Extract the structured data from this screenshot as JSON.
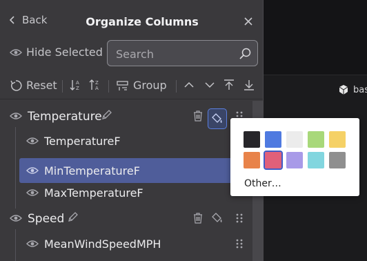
{
  "header": {
    "back_label": "Back",
    "title": "Organize Columns"
  },
  "controls": {
    "hide_selected_label": "Hide Selected",
    "search_placeholder": "Search"
  },
  "toolbar": {
    "reset_label": "Reset",
    "group_label": "Group"
  },
  "columns": [
    {
      "label": "Temperature",
      "type": "group"
    },
    {
      "label": "TemperatureF",
      "type": "child"
    },
    {
      "label": "MinTemperatureF",
      "type": "child",
      "selected": true
    },
    {
      "label": "MaxTemperatureF",
      "type": "child"
    },
    {
      "label": "Speed",
      "type": "group"
    },
    {
      "label": "MeanWindSpeedMPH",
      "type": "child"
    }
  ],
  "color_popup": {
    "swatches": [
      "#27262a",
      "#4f7ae0",
      "#ececec",
      "#a8d87a",
      "#f5d166",
      "#e8834a",
      "#e0607a",
      "#a89ae8",
      "#82d6df",
      "#8f8f8f"
    ],
    "selected_index": 6,
    "other_label": "Other…"
  },
  "background": {
    "file_label": "bas"
  }
}
